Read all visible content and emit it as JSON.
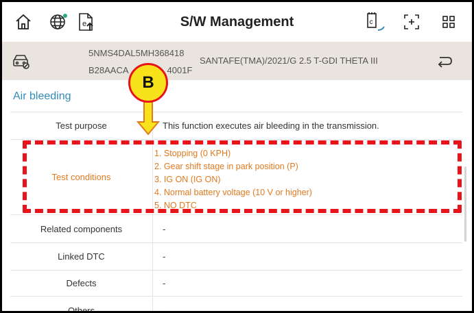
{
  "header": {
    "title": "S/W Management",
    "icons": [
      "home-icon",
      "globe-settings-icon",
      "document-upload-icon",
      "device-screen-icon",
      "screen-capture-icon",
      "apps-grid-icon"
    ]
  },
  "vehicle": {
    "vin_line1": "5NMS4DAL5MH368418",
    "vin_line2": "B28AACA",
    "vin_line2_tail": "4001F",
    "model": "SANTAFE(TMA)/2021/G 2.5 T-GDI THETA III"
  },
  "section": {
    "title": "Air bleeding"
  },
  "rows": [
    {
      "label": "Test purpose",
      "value": "This function executes air bleeding in the transmission."
    },
    {
      "label": "Test conditions",
      "items": [
        "1. Stopping (0 KPH)",
        "2. Gear shift stage in park position (P)",
        "3. IG ON (IG ON)",
        "4. Normal battery voltage (10 V or higher)",
        "5. NO DTC"
      ]
    },
    {
      "label": "Related components",
      "value": "-"
    },
    {
      "label": "Linked DTC",
      "value": "-"
    },
    {
      "label": "Defects",
      "value": "-"
    },
    {
      "label": "Others",
      "value": "-"
    }
  ],
  "callout": {
    "label": "B"
  },
  "colors": {
    "accent": "#2f8bb8",
    "condition": "#e07a1f",
    "annotation": "#e8141c",
    "badge": "#f7e21b",
    "vehicle_bar": "#e9e4de"
  }
}
